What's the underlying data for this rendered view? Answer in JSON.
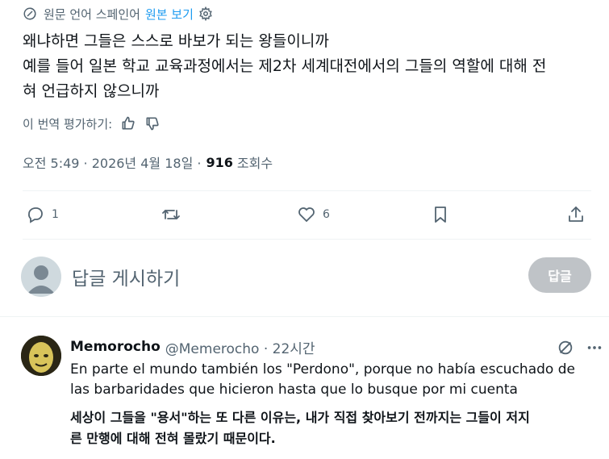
{
  "translation": {
    "label": "원문 언어 스페인어",
    "show_original": "원본 보기",
    "icon": "globe-translate-icon",
    "settings_icon": "gear-icon"
  },
  "tweet": {
    "lines": [
      "왜냐하면 그들은 스스로 바보가 되는 왕들이니까",
      "예를 들어 일본 학교 교육과정에서는 제2차 세계대전에서의 그들의 역할에 대해 전",
      "혀 언급하지 않으니까"
    ],
    "rate_label": "이 번역 평가하기:",
    "timestamp": "오전 5:49 · 2026년 4월 18일 ·",
    "views_count": "916",
    "views_label": "조회수"
  },
  "actions": {
    "reply_count": "1",
    "retweet_count": "",
    "like_count": "6"
  },
  "composer": {
    "placeholder": "답글 게시하기",
    "button_label": "답글"
  },
  "reply": {
    "name": "Memorocho",
    "handle": "@Memerocho · 22시간",
    "lines": [
      "En parte el mundo también los \"Perdono\", porque no había escuchado de",
      "las barbaridades que hicieron hasta que lo busque por mi cuenta"
    ],
    "translation_lines": [
      "세상이 그들을 \"용서\"하는 또 다른 이유는, 내가 직접 찾아보기 전까지는 그들이 저지",
      "른 만행에 대해 전혀 몰랐기 때문이다."
    ]
  },
  "colors": {
    "accent": "#1d9bf0",
    "muted": "#536471",
    "text": "#0f1419",
    "button_disabled": "#bfc3c7"
  }
}
